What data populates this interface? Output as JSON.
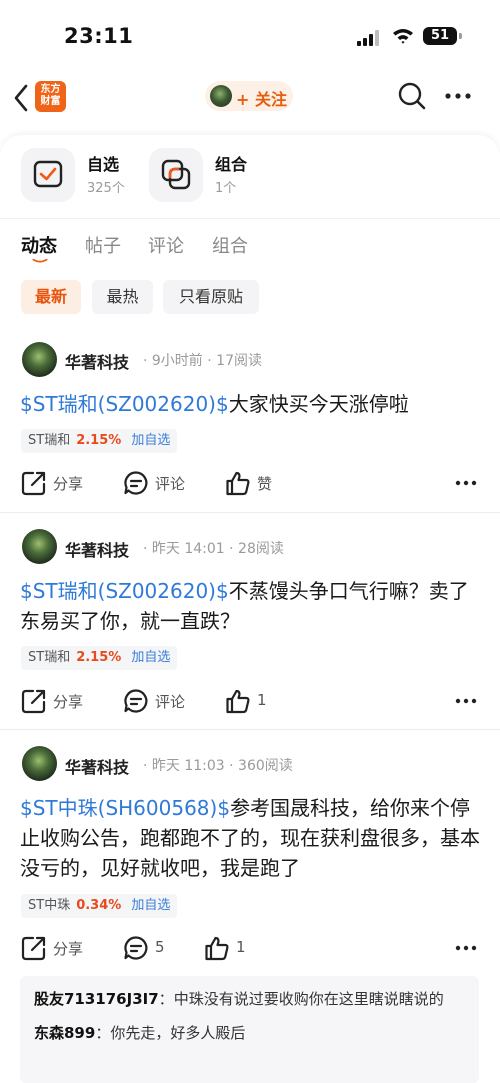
{
  "status_bar": {
    "time": "23:11",
    "battery": "51"
  },
  "nav": {
    "logo_text_line1": "东方",
    "logo_text_line2": "财富",
    "follow_label": "+ 关注"
  },
  "quick_links": [
    {
      "title": "自选",
      "subtitle": "325个"
    },
    {
      "title": "组合",
      "subtitle": "1个"
    }
  ],
  "tabs": [
    {
      "label": "动态",
      "active": true
    },
    {
      "label": "帖子",
      "active": false
    },
    {
      "label": "评论",
      "active": false
    },
    {
      "label": "组合",
      "active": false
    }
  ],
  "filters": [
    {
      "label": "最新",
      "active": true
    },
    {
      "label": "最热",
      "active": false
    },
    {
      "label": "只看原贴",
      "active": false
    }
  ],
  "posts": [
    {
      "author": "华著科技",
      "meta": "· 9小时前 · 17阅读",
      "stock_link": "$ST瑞和(SZ002620)$",
      "text": "大家快买今天涨停啦",
      "tag": {
        "name": "ST瑞和",
        "pct": "2.15%",
        "add": "加自选"
      },
      "share": "分享",
      "comment": "评论",
      "like": "赞"
    },
    {
      "author": "华著科技",
      "meta": "· 昨天 14:01 · 28阅读",
      "stock_link": "$ST瑞和(SZ002620)$",
      "text": "不蒸馒头争口气行嘛？卖了东易买了你，就一直跌？",
      "tag": {
        "name": "ST瑞和",
        "pct": "2.15%",
        "add": "加自选"
      },
      "share": "分享",
      "comment": "评论",
      "like": "1"
    },
    {
      "author": "华著科技",
      "meta": "· 昨天 11:03 · 360阅读",
      "stock_link": "$ST中珠(SH600568)$",
      "text": "参考国晟科技，给你来个停止收购公告，跑都跑不了的，现在获利盘很多，基本没亏的，见好就收吧，我是跑了",
      "tag": {
        "name": "ST中珠",
        "pct": "0.34%",
        "add": "加自选"
      },
      "share": "分享",
      "comment": "5",
      "like": "1"
    }
  ],
  "comments": [
    {
      "user": "股友713176J3I7",
      "text": "中珠没有说过要收购你在这里瞎说瞎说的"
    },
    {
      "user": "东森899",
      "text": "你先走，好多人殿后"
    }
  ],
  "colors": {
    "accent": "#e8550e",
    "link": "#2f7ad8",
    "rise": "#e94a1c"
  }
}
